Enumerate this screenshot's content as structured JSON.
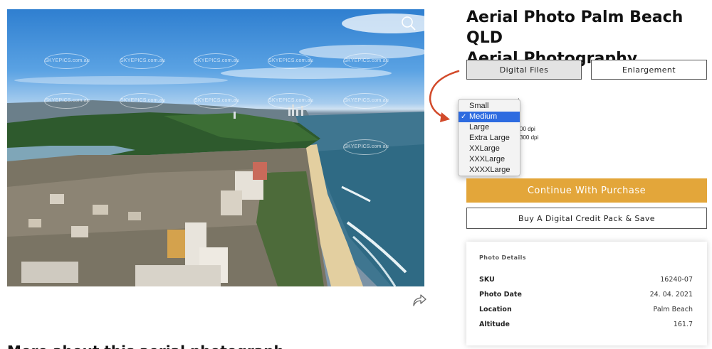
{
  "product": {
    "title_line1": "Aerial Photo Palm Beach QLD",
    "title_line2": "Aerial Photography"
  },
  "photo": {
    "alt": "Aerial view of Palm Beach coastline, Gold Coast",
    "watermark_text": "SKYEPICS.com.au",
    "zoom_icon": "magnifier-icon",
    "share_icon": "share-arrow-icon"
  },
  "tabs": {
    "digital_files": "Digital Files",
    "enlargement": "Enlargement",
    "selected": "Digital Files"
  },
  "size_select": {
    "options": [
      "Small",
      "Medium",
      "Large",
      "Extra Large",
      "XXLarge",
      "XXXLarge",
      "XXXXLarge"
    ],
    "selected": "Medium",
    "partial_colon": ":",
    "partial_dpi_1": "00 dpi",
    "partial_dpi_2": "300 dpi"
  },
  "actions": {
    "continue_label": "Continue With Purchase",
    "credit_pack_label": "Buy A Digital Credit Pack & Save"
  },
  "details": {
    "heading": "Photo Details",
    "rows": [
      {
        "label": "SKU",
        "value": "16240-07"
      },
      {
        "label": "Photo Date",
        "value": "24. 04. 2021"
      },
      {
        "label": "Location",
        "value": "Palm Beach"
      },
      {
        "label": "Altitude",
        "value": "161.7"
      }
    ]
  },
  "more": {
    "heading": "More about this aerial photograph"
  },
  "colors": {
    "accent_orange": "#e3a63a",
    "arrow_red": "#d24a2a",
    "select_blue": "#2d6be0"
  }
}
